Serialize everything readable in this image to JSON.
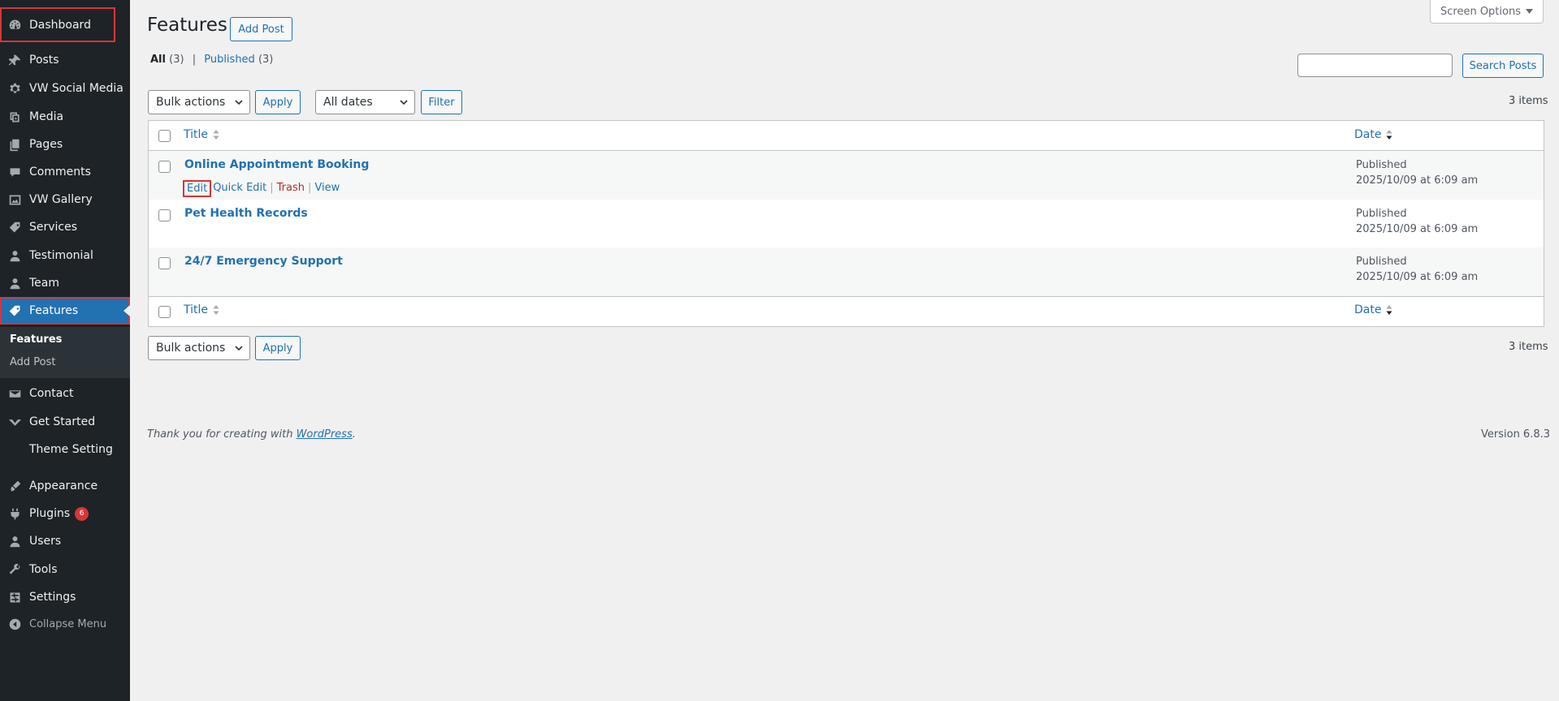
{
  "sidebar": {
    "items": [
      {
        "label": "Dashboard",
        "icon": "dashboard-icon"
      },
      {
        "label": "Posts",
        "icon": "pin-icon"
      },
      {
        "label": "VW Social Media",
        "icon": "gear-icon"
      },
      {
        "label": "Media",
        "icon": "media-icon"
      },
      {
        "label": "Pages",
        "icon": "pages-icon"
      },
      {
        "label": "Comments",
        "icon": "comment-icon"
      },
      {
        "label": "VW Gallery",
        "icon": "gallery-icon"
      },
      {
        "label": "Services",
        "icon": "tag-icon"
      },
      {
        "label": "Testimonial",
        "icon": "user-icon"
      },
      {
        "label": "Team",
        "icon": "user-icon"
      },
      {
        "label": "Features",
        "icon": "tag-icon"
      },
      {
        "label": "Contact",
        "icon": "mail-icon"
      },
      {
        "label": "Get Started",
        "icon": "chevron-down-icon"
      },
      {
        "label": "Theme Setting",
        "icon": ""
      },
      {
        "label": "Appearance",
        "icon": "brush-icon"
      },
      {
        "label": "Plugins",
        "icon": "plug-icon",
        "badge": "6"
      },
      {
        "label": "Users",
        "icon": "user-icon"
      },
      {
        "label": "Tools",
        "icon": "wrench-icon"
      },
      {
        "label": "Settings",
        "icon": "settings-icon"
      },
      {
        "label": "Collapse Menu",
        "icon": "collapse-icon"
      }
    ],
    "submenu": {
      "current": "Features",
      "add": "Add Post"
    }
  },
  "header": {
    "screen_options": "Screen Options",
    "title": "Features",
    "add_post": "Add Post"
  },
  "filters": {
    "all_label": "All",
    "all_count": "(3)",
    "separator": "|",
    "published_label": "Published",
    "published_count": "(3)",
    "search_button": "Search Posts",
    "bulk_actions": "Bulk actions",
    "apply": "Apply",
    "all_dates": "All dates",
    "filter": "Filter",
    "items_count": "3 items"
  },
  "table": {
    "col_title": "Title",
    "col_date": "Date",
    "rows": [
      {
        "title": "Online Appointment Booking",
        "status": "Published",
        "date": "2025/10/09 at 6:09 am"
      },
      {
        "title": "Pet Health Records",
        "status": "Published",
        "date": "2025/10/09 at 6:09 am"
      },
      {
        "title": "24/7 Emergency Support",
        "status": "Published",
        "date": "2025/10/09 at 6:09 am"
      }
    ],
    "row_actions": {
      "edit": "Edit",
      "quick_edit": "Quick Edit",
      "trash": "Trash",
      "view": "View",
      "sep": "|"
    }
  },
  "footer": {
    "thanks_prefix": "Thank you for creating with ",
    "thanks_link": "WordPress",
    "thanks_suffix": ".",
    "version": "Version 6.8.3"
  },
  "colors": {
    "sidebar_bg": "#1d2327",
    "accent": "#2271b1",
    "highlight_box": "#d63638"
  }
}
